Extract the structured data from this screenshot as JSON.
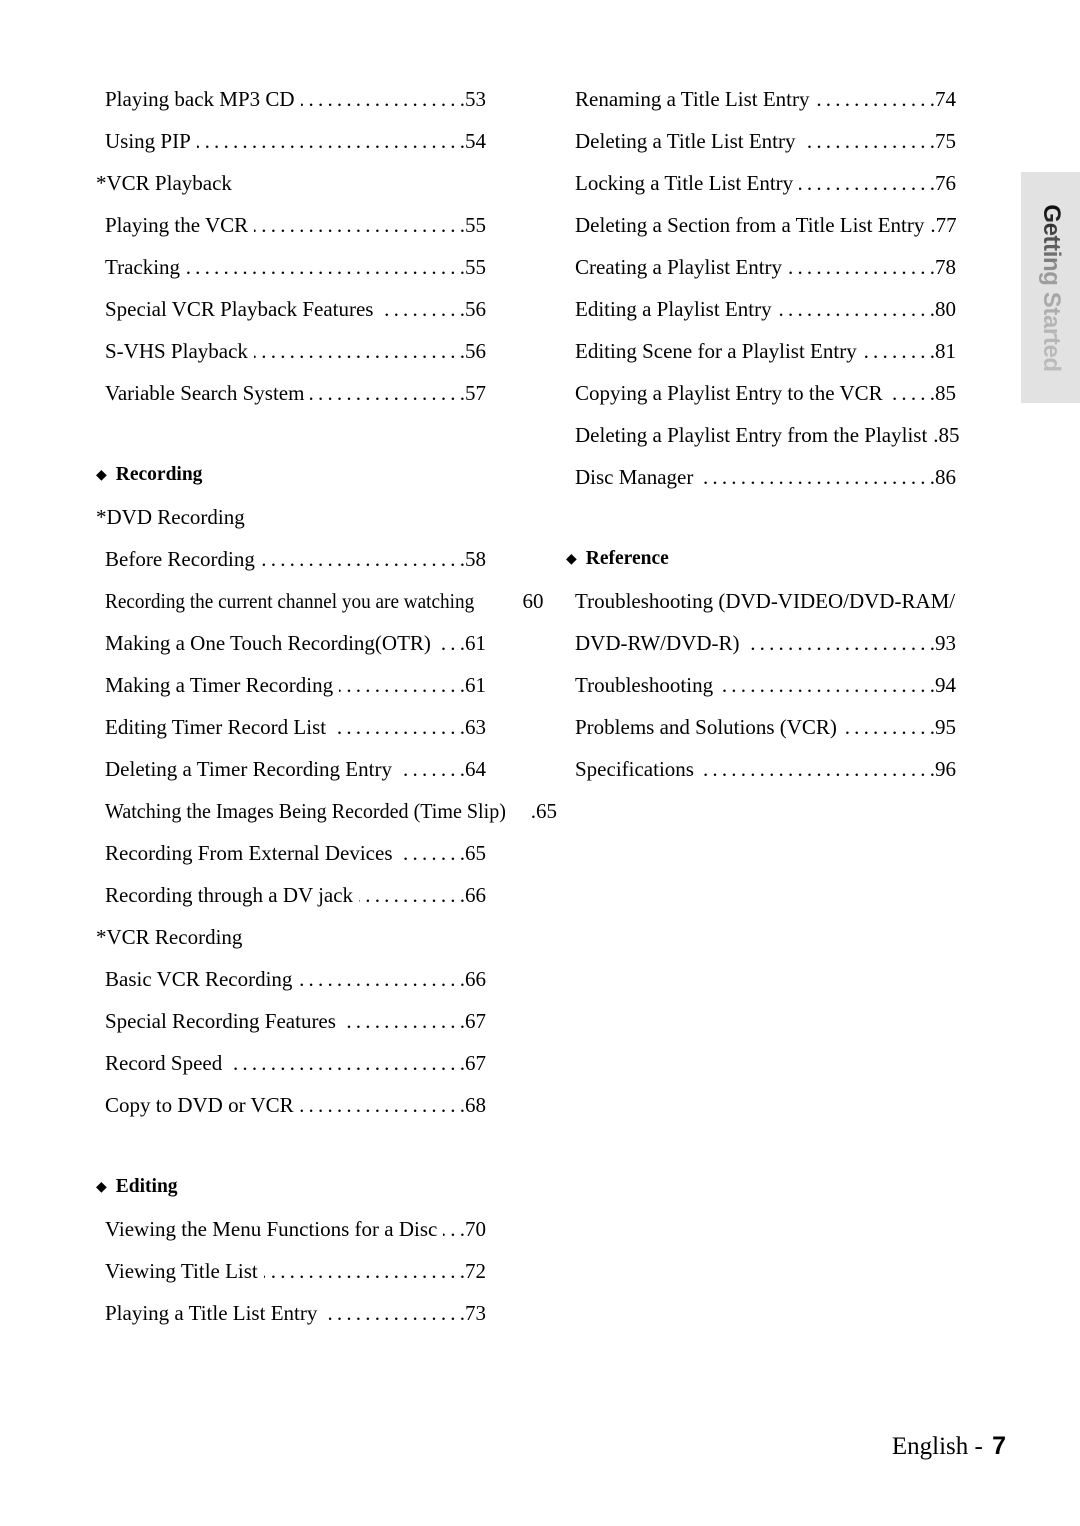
{
  "side_tab": {
    "label": "Getting Started",
    "bg_color": "#e2e2e2",
    "text_gradient_from": "#0a0a0a",
    "text_gradient_to": "#bcbcbc"
  },
  "footer": {
    "language": "English - ",
    "page_number": "7"
  },
  "icons": {
    "section_bullet": "◆"
  },
  "left_column": [
    {
      "kind": "entry",
      "text": "Playing back MP3 CD",
      "page": ".53"
    },
    {
      "kind": "entry",
      "text": "Using PIP",
      "page": ".54"
    },
    {
      "kind": "sub_head",
      "text": "*VCR Playback"
    },
    {
      "kind": "entry",
      "text": "Playing the VCR",
      "page": ".55"
    },
    {
      "kind": "entry",
      "text": "Tracking",
      "page": ".55"
    },
    {
      "kind": "entry",
      "text": "Special VCR Playback Features",
      "page": ".56"
    },
    {
      "kind": "entry",
      "text": "S-VHS Playback",
      "page": ".56"
    },
    {
      "kind": "entry",
      "text": "Variable Search System",
      "page": ".57"
    },
    {
      "kind": "spacer"
    },
    {
      "kind": "section",
      "text": "Recording"
    },
    {
      "kind": "sub_head",
      "text": "*DVD Recording"
    },
    {
      "kind": "entry",
      "text": "Before Recording",
      "page": ".58"
    },
    {
      "kind": "entry_plain",
      "text": "Recording the current channel you are watching",
      "page": "60"
    },
    {
      "kind": "entry",
      "text": "Making a One Touch Recording(OTR)",
      "page": ".61"
    },
    {
      "kind": "entry",
      "text": "Making a Timer Recording",
      "page": ".61"
    },
    {
      "kind": "entry",
      "text": "Editing Timer Record List",
      "page": ".63"
    },
    {
      "kind": "entry",
      "text": "Deleting a Timer Recording Entry",
      "page": ".64"
    },
    {
      "kind": "entry_tight",
      "text": "Watching the Images Being Recorded (Time Slip)",
      "page": ".65"
    },
    {
      "kind": "entry",
      "text": "Recording From External Devices",
      "page": ".65"
    },
    {
      "kind": "entry",
      "text": "Recording through a DV jack",
      "page": ".66"
    },
    {
      "kind": "sub_head",
      "text": "*VCR Recording"
    },
    {
      "kind": "entry",
      "text": "Basic VCR Recording",
      "page": ".66"
    },
    {
      "kind": "entry",
      "text": "Special Recording Features",
      "page": ".67"
    },
    {
      "kind": "entry",
      "text": "Record Speed",
      "page": ".67"
    },
    {
      "kind": "entry",
      "text": "Copy to DVD or VCR",
      "page": ".68"
    },
    {
      "kind": "spacer"
    },
    {
      "kind": "section",
      "text": "Editing"
    },
    {
      "kind": "entry",
      "text": "Viewing the Menu Functions for a Disc",
      "page": ".70"
    },
    {
      "kind": "entry",
      "text": "Viewing Title List",
      "page": ".72"
    },
    {
      "kind": "entry",
      "text": "Playing a Title List Entry",
      "page": ".73"
    }
  ],
  "right_column": [
    {
      "kind": "entry",
      "text": "Renaming a Title List Entry",
      "page": ".74"
    },
    {
      "kind": "entry",
      "text": "Deleting a Title List Entry",
      "page": ".75"
    },
    {
      "kind": "entry",
      "text": "Locking a Title List Entry",
      "page": ".76"
    },
    {
      "kind": "entry",
      "text": "Deleting a Section from a Title List Entry",
      "page": ".77"
    },
    {
      "kind": "entry",
      "text": "Creating a Playlist Entry",
      "page": ".78"
    },
    {
      "kind": "entry",
      "text": "Editing a Playlist Entry",
      "page": ".80"
    },
    {
      "kind": "entry",
      "text": "Editing Scene for a Playlist Entry",
      "page": ".81"
    },
    {
      "kind": "entry",
      "text": "Copying a Playlist Entry to the VCR",
      "page": ".85"
    },
    {
      "kind": "entry",
      "text": "Deleting a Playlist Entry from the Playlist",
      "page": ".85"
    },
    {
      "kind": "entry",
      "text": "Disc Manager",
      "page": ".86"
    },
    {
      "kind": "spacer"
    },
    {
      "kind": "section",
      "text": "Reference"
    },
    {
      "kind": "entry_wrap",
      "text": "Troubleshooting (DVD-VIDEO/DVD-RAM/"
    },
    {
      "kind": "entry",
      "text": "DVD-RW/DVD-R)",
      "page": ".93"
    },
    {
      "kind": "entry",
      "text": "Troubleshooting",
      "page": ".94"
    },
    {
      "kind": "entry",
      "text": "Problems and Solutions (VCR)",
      "page": ".95"
    },
    {
      "kind": "entry",
      "text": "Specifications",
      "page": ".96"
    }
  ]
}
